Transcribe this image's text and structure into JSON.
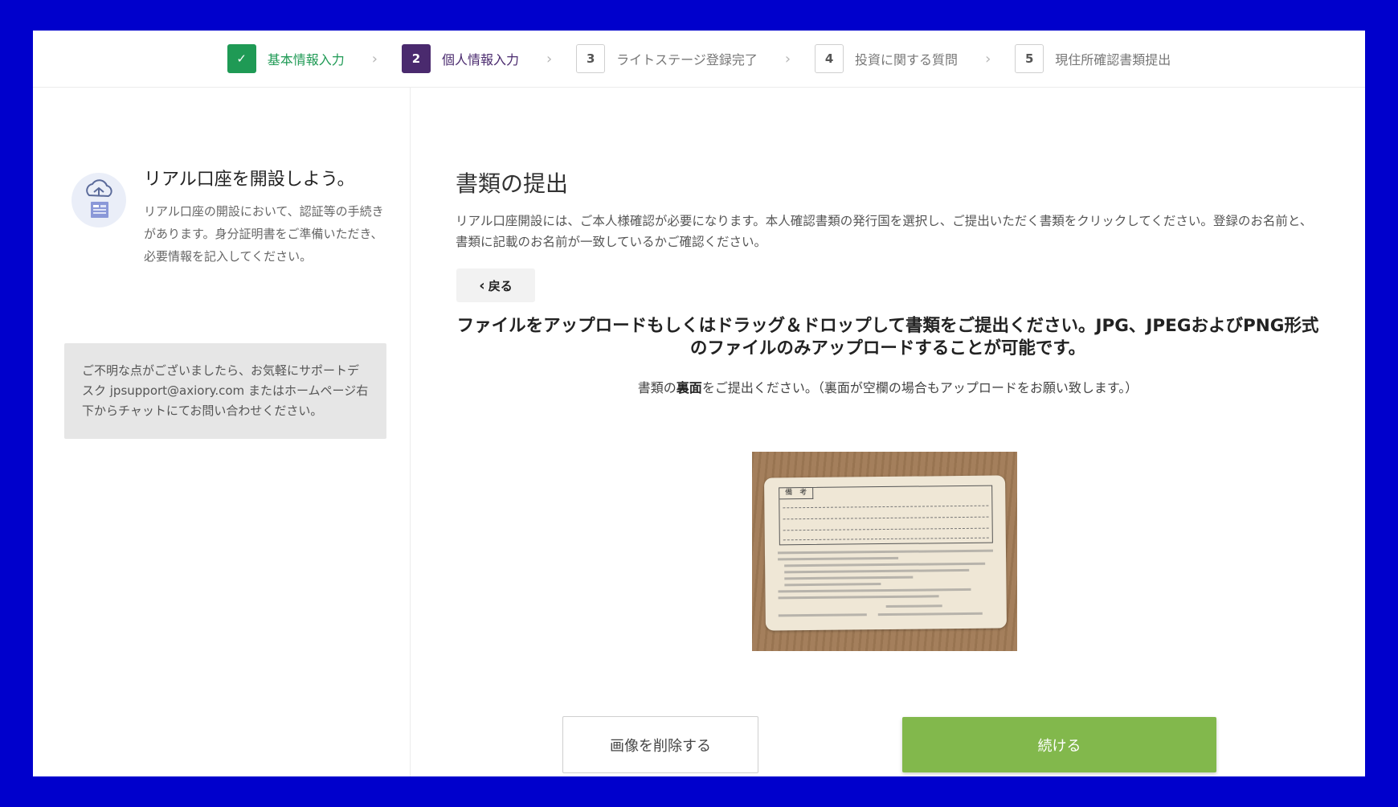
{
  "stepper": {
    "steps": [
      {
        "badge": "✓",
        "label": "基本情報入力",
        "state": "done"
      },
      {
        "badge": "2",
        "label": "個人情報入力",
        "state": "active"
      },
      {
        "badge": "3",
        "label": "ライトステージ登録完了",
        "state": "pending"
      },
      {
        "badge": "4",
        "label": "投資に関する質問",
        "state": "pending"
      },
      {
        "badge": "5",
        "label": "現住所確認書類提出",
        "state": "pending"
      }
    ],
    "separator": "›"
  },
  "sidebar": {
    "icon": "cloud-document-icon",
    "title": "リアル口座を開設しよう。",
    "description": "リアル口座の開設において、認証等の手続きがあります。身分証明書をご準備いただき、必要情報を記入してください。",
    "support_text": "ご不明な点がございましたら、お気軽にサポートデスク jpsupport@axiory.com またはホームページ右下からチャットにてお問い合わせください。"
  },
  "main": {
    "title": "書類の提出",
    "description": "リアル口座開設には、ご本人様確認が必要になります。本人確認書類の発行国を選択し、ご提出いただく書類をクリックしてください。登録のお名前と、書類に記載のお名前が一致しているかご確認ください。",
    "back_label": "戻る",
    "upload_heading": "ファイルをアップロードもしくはドラッグ＆ドロップして書類をご提出ください。JPG、JPEGおよびPNG形式のファイルのみアップロードすることが可能です。",
    "upload_sub_prefix": "書類の",
    "upload_sub_bold": "裏面",
    "upload_sub_suffix": "をご提出ください。（裏面が空欄の場合もアップロードをお願い致します。）",
    "preview_card_label": "備　考",
    "delete_label": "画像を削除する",
    "continue_label": "続ける"
  },
  "colors": {
    "frame": "#0000cc",
    "done": "#1f9a55",
    "active": "#4a2a6e",
    "continue": "#82b84c"
  }
}
